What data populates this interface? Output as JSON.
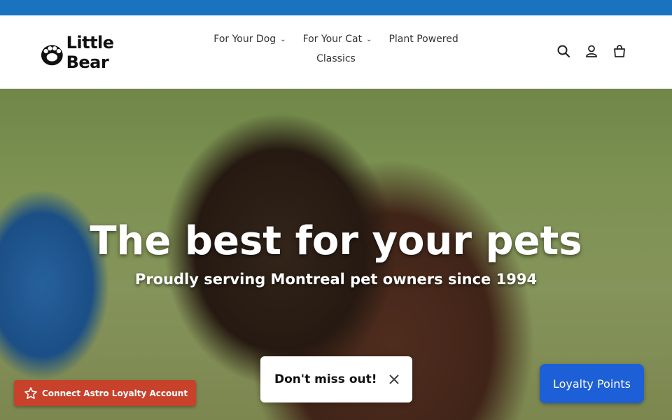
{
  "brand": {
    "name": "Little Bear"
  },
  "nav": {
    "items": [
      {
        "label": "For Your Dog",
        "has_dropdown": true
      },
      {
        "label": "For Your Cat",
        "has_dropdown": true
      },
      {
        "label": "Plant Powered",
        "has_dropdown": false
      },
      {
        "label": "Classics",
        "has_dropdown": false
      }
    ]
  },
  "header_icons": [
    "search-icon",
    "account-icon",
    "cart-icon"
  ],
  "hero": {
    "title": "The best for your pets",
    "subtitle": "Proudly serving Montreal pet owners since 1994"
  },
  "astro": {
    "label": "Connect Astro Loyalty Account"
  },
  "popup": {
    "text": "Don't miss out!"
  },
  "loyalty": {
    "label": "Loyalty Points"
  },
  "colors": {
    "topbar": "#1a73be",
    "astro_button": "#c8412b",
    "loyalty_button": "#1c5fd6"
  }
}
